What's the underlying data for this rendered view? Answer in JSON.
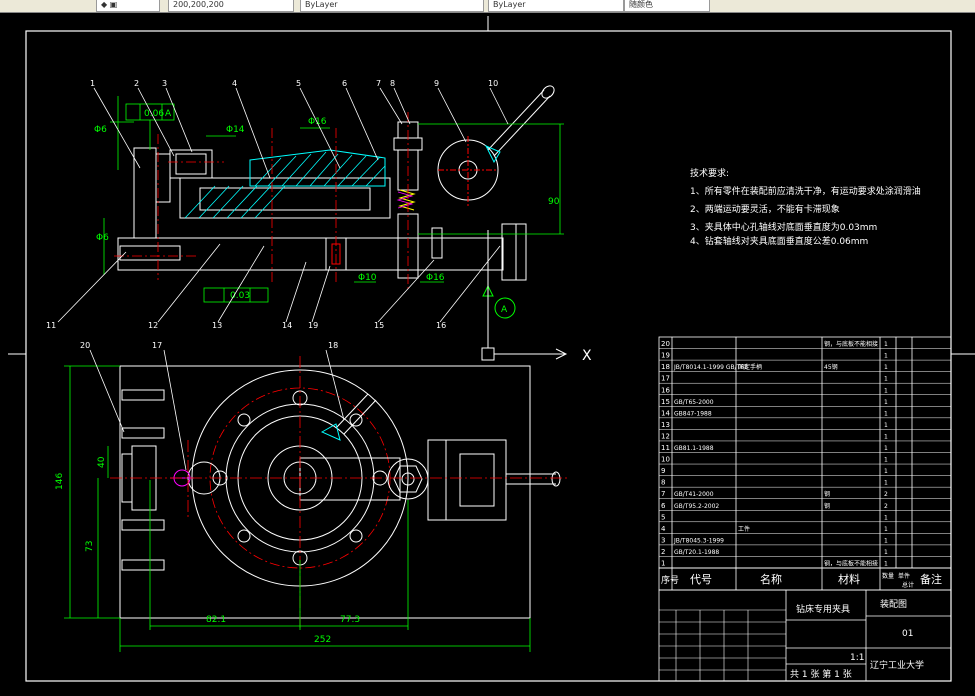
{
  "toolbar": {
    "tabs": [
      "200,200,200",
      "ByLayer",
      "ByLayer",
      "随颜色"
    ]
  },
  "drawing": {
    "part_numbers_top": [
      "1",
      "2",
      "3",
      "4",
      "5",
      "6",
      "7",
      "8",
      "9",
      "10"
    ],
    "part_numbers_bottom": [
      "11",
      "12",
      "13",
      "14",
      "19",
      "15",
      "16"
    ],
    "part_numbers_plan": [
      "20",
      "17",
      "18"
    ],
    "dim_texts": {
      "d1": "Φ6",
      "d2": "0.06",
      "d3": "A",
      "d4": "Φ14",
      "d5": "Φ16",
      "d6": "90",
      "d7": "Φ6",
      "d8": "0.03",
      "d9": "Φ10",
      "d10": "Φ16",
      "d11": "A",
      "d12": "146",
      "d13": "40",
      "d14": "73",
      "d15": "82.1",
      "d16": "77.3",
      "d17": "252"
    },
    "axis_x": "X"
  },
  "tech_notes": {
    "title": "技术要求:",
    "items": [
      "1、所有零件在装配前应清洗干净，有运动要求处涂润滑油",
      "2、两端运动要灵活，不能有卡滞现象",
      "3、夹具体中心孔轴线对底面垂直度为0.03mm",
      "4、钻套轴线对夹具底面垂直度公差0.06mm"
    ]
  },
  "bom": {
    "rows": [
      {
        "no": "20",
        "code": "",
        "name": "",
        "qty": "1",
        "material": "钢，与底板不能相接",
        "note": ""
      },
      {
        "no": "19",
        "code": "",
        "name": "",
        "qty": "1",
        "material": "",
        "note": ""
      },
      {
        "no": "18",
        "code": "JB/T8014.1-1999 GB/T68",
        "name": "固定手柄",
        "qty": "1",
        "material": "45钢",
        "note": ""
      },
      {
        "no": "17",
        "code": "",
        "name": "",
        "qty": "1",
        "material": "",
        "note": ""
      },
      {
        "no": "16",
        "code": "",
        "name": "",
        "qty": "1",
        "material": "",
        "note": ""
      },
      {
        "no": "15",
        "code": "GB/T65-2000",
        "name": "",
        "qty": "1",
        "material": "",
        "note": ""
      },
      {
        "no": "14",
        "code": "GB847-1988",
        "name": "",
        "qty": "1",
        "material": "",
        "note": ""
      },
      {
        "no": "13",
        "code": "",
        "name": "",
        "qty": "1",
        "material": "",
        "note": ""
      },
      {
        "no": "12",
        "code": "",
        "name": "",
        "qty": "1",
        "material": "",
        "note": ""
      },
      {
        "no": "11",
        "code": "GB81.1-1988",
        "name": "",
        "qty": "1",
        "material": "",
        "note": ""
      },
      {
        "no": "10",
        "code": "",
        "name": "",
        "qty": "1",
        "material": "",
        "note": ""
      },
      {
        "no": "9",
        "code": "",
        "name": "",
        "qty": "1",
        "material": "",
        "note": ""
      },
      {
        "no": "8",
        "code": "",
        "name": "",
        "qty": "1",
        "material": "",
        "note": ""
      },
      {
        "no": "7",
        "code": "GB/T41-2000",
        "name": "",
        "qty": "2",
        "material": "钢",
        "note": ""
      },
      {
        "no": "6",
        "code": "GB/T95.2-2002",
        "name": "",
        "qty": "2",
        "material": "钢",
        "note": ""
      },
      {
        "no": "5",
        "code": "",
        "name": "",
        "qty": "1",
        "material": "",
        "note": ""
      },
      {
        "no": "4",
        "code": "",
        "name": "工件",
        "qty": "1",
        "material": "",
        "note": ""
      },
      {
        "no": "3",
        "code": "JB/T8045.3-1999",
        "name": "",
        "qty": "1",
        "material": "",
        "note": ""
      },
      {
        "no": "2",
        "code": "GB/T20.1-1988",
        "name": "",
        "qty": "1",
        "material": "",
        "note": ""
      },
      {
        "no": "1",
        "code": "",
        "name": "",
        "qty": "1",
        "material": "钢，与底板不能相接",
        "note": ""
      }
    ],
    "headers": {
      "no": "序号",
      "code": "代号",
      "name": "名称",
      "qty": "数量",
      "material": "材料",
      "unit_w": "单件",
      "total_w": "总计",
      "weight": "重量",
      "note": "备注"
    }
  },
  "title_block": {
    "product": "钻床专用夹具",
    "drawing_type": "装配图",
    "drawing_no": "01",
    "company": "辽宁工业大学",
    "scale": "1:1",
    "sheet": "共 1 张 第 1 张"
  },
  "colors": {
    "background": "#000000",
    "outline": "#ffffff",
    "dimension": "#00ff00",
    "centerline": "#ff0000",
    "hatch": "#00ffff",
    "leader": "#ffffff",
    "text_yellow": "#ffff00",
    "text_magenta": "#ff00ff"
  }
}
